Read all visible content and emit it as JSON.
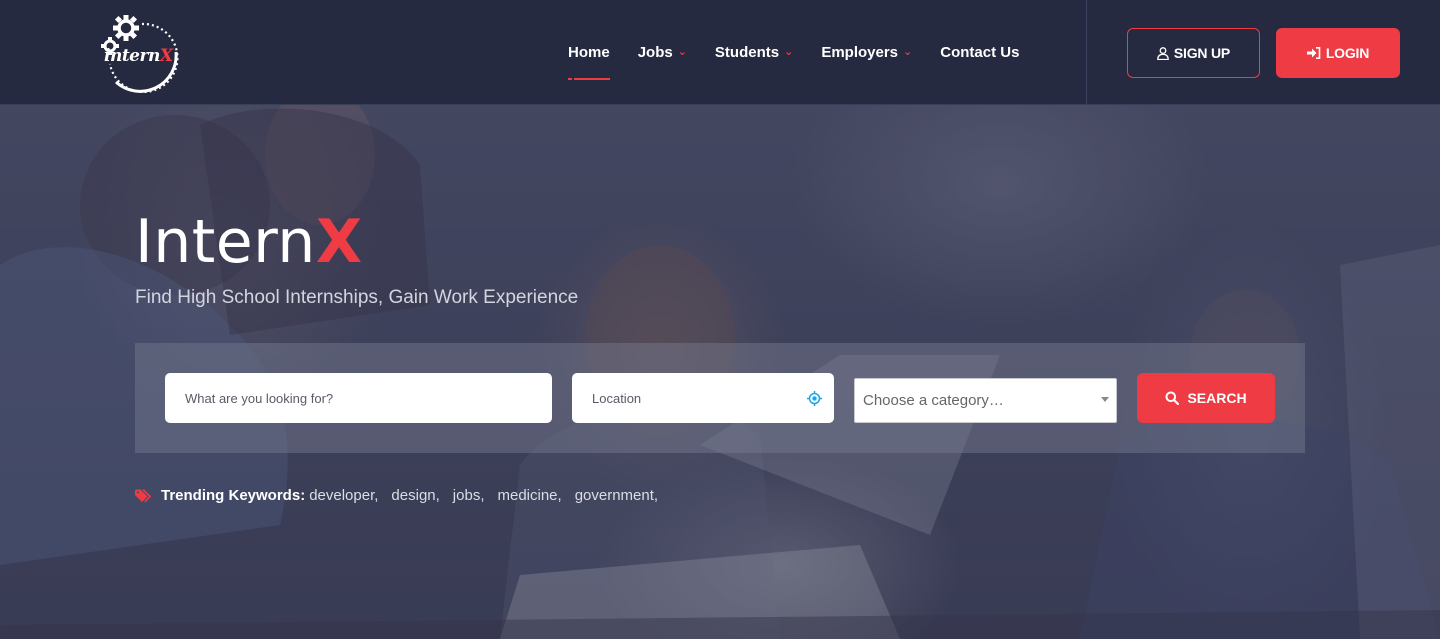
{
  "brand": {
    "logo_text": "internX",
    "logo_accent": "X",
    "accent_color": "#ef3b43",
    "header_bg": "#262a40"
  },
  "nav": {
    "items": [
      {
        "label": "Home",
        "active": true,
        "dropdown": false
      },
      {
        "label": "Jobs",
        "active": false,
        "dropdown": true
      },
      {
        "label": "Students",
        "active": false,
        "dropdown": true
      },
      {
        "label": "Employers",
        "active": false,
        "dropdown": true
      },
      {
        "label": "Contact Us",
        "active": false,
        "dropdown": false
      }
    ],
    "dropdown_icon": "chevron-down-icon"
  },
  "auth": {
    "signup_label": "SIGN UP",
    "signup_icon": "user-icon",
    "login_label": "LOGIN",
    "login_icon": "sign-in-icon"
  },
  "hero": {
    "title_main": "Intern",
    "title_accent": "X",
    "subtitle": "Find High School Internships, Gain Work Experience"
  },
  "search": {
    "keyword_placeholder": "What are you looking for?",
    "location_placeholder": "Location",
    "location_icon": "crosshair-icon",
    "category_selected": "Choose a category…",
    "button_label": "SEARCH",
    "button_icon": "search-icon"
  },
  "trending": {
    "label": "Trending Keywords:",
    "icon": "tags-icon",
    "keywords": [
      "developer,",
      "design,",
      "jobs,",
      "medicine,",
      "government,"
    ]
  }
}
